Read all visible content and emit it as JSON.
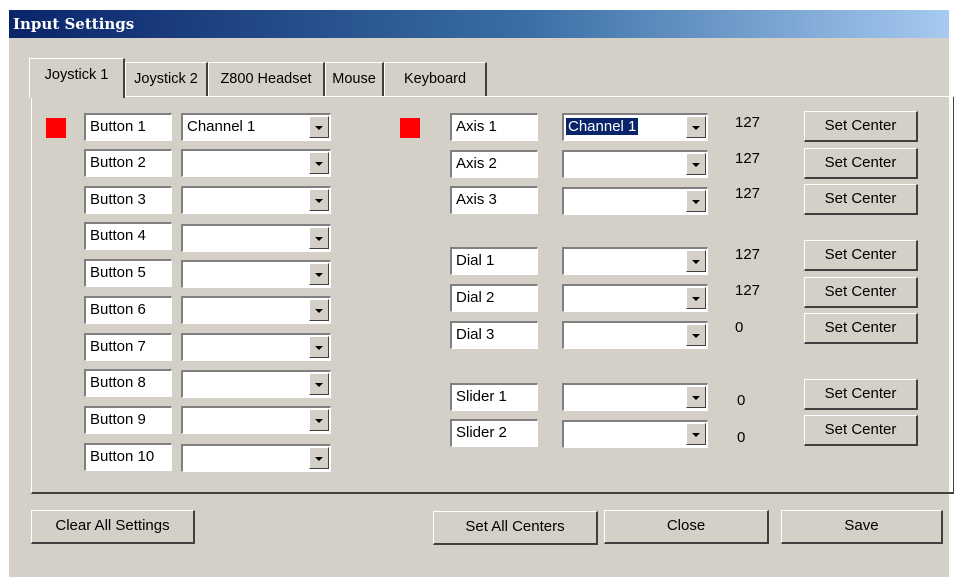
{
  "window": {
    "title": "Input Settings"
  },
  "tabs": [
    {
      "label": "Joystick 1",
      "active": true
    },
    {
      "label": "Joystick 2",
      "active": false
    },
    {
      "label": "Z800 Headset",
      "active": false
    },
    {
      "label": "Mouse",
      "active": false
    },
    {
      "label": "Keyboard",
      "active": false
    }
  ],
  "colors": {
    "indicator": "#ff0000",
    "title_bar": "#0a246a",
    "face": "#d4d0c8"
  },
  "buttons": [
    {
      "label": "Button 1",
      "channel": "Channel 1"
    },
    {
      "label": "Button 2",
      "channel": ""
    },
    {
      "label": "Button 3",
      "channel": ""
    },
    {
      "label": "Button 4",
      "channel": ""
    },
    {
      "label": "Button 5",
      "channel": ""
    },
    {
      "label": "Button 6",
      "channel": ""
    },
    {
      "label": "Button 7",
      "channel": ""
    },
    {
      "label": "Button 8",
      "channel": ""
    },
    {
      "label": "Button 9",
      "channel": ""
    },
    {
      "label": "Button 10",
      "channel": ""
    }
  ],
  "axes": [
    {
      "label": "Axis 1",
      "channel": "Channel 1",
      "value": "127",
      "button": "Set Center"
    },
    {
      "label": "Axis 2",
      "channel": "",
      "value": "127",
      "button": "Set Center"
    },
    {
      "label": "Axis 3",
      "channel": "",
      "value": "127",
      "button": "Set Center"
    },
    {
      "label": "Dial 1",
      "channel": "",
      "value": "127",
      "button": "Set Center"
    },
    {
      "label": "Dial 2",
      "channel": "",
      "value": "127",
      "button": "Set Center"
    },
    {
      "label": "Dial 3",
      "channel": "",
      "value": "0",
      "button": "Set Center"
    },
    {
      "label": "Slider 1",
      "channel": "",
      "value": "0",
      "button": "Set Center"
    },
    {
      "label": "Slider 2",
      "channel": "",
      "value": "0",
      "button": "Set Center"
    }
  ],
  "footer": {
    "clear_all": "Clear All Settings",
    "set_all_centers": "Set All Centers",
    "close": "Close",
    "save": "Save"
  }
}
